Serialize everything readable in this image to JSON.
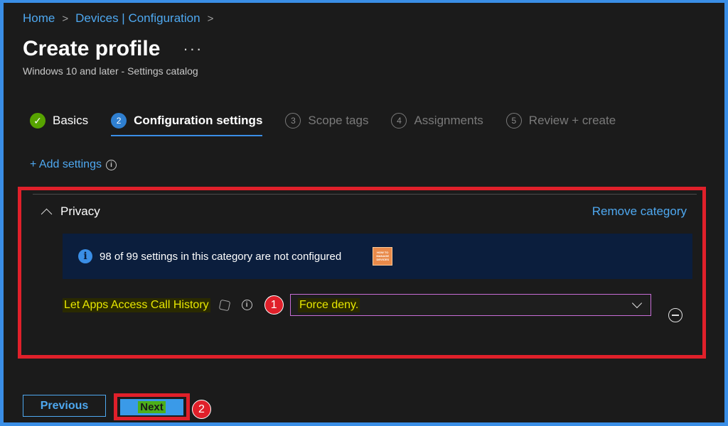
{
  "breadcrumb": {
    "items": [
      "Home",
      "Devices | Configuration"
    ]
  },
  "header": {
    "title": "Create profile",
    "more": "···",
    "subtitle": "Windows 10 and later - Settings catalog"
  },
  "steps": [
    {
      "num": "✓",
      "label": "Basics",
      "state": "done"
    },
    {
      "num": "2",
      "label": "Configuration settings",
      "state": "active"
    },
    {
      "num": "3",
      "label": "Scope tags",
      "state": "pending"
    },
    {
      "num": "4",
      "label": "Assignments",
      "state": "pending"
    },
    {
      "num": "5",
      "label": "Review + create",
      "state": "pending"
    }
  ],
  "add_settings": {
    "label": "+ Add settings",
    "info": "i"
  },
  "category": {
    "name": "Privacy",
    "remove_label": "Remove category",
    "info_text": "98 of 99 settings in this category are not configured",
    "info_icon": "i",
    "logo_lines": [
      "HOW TO",
      "MANAGE",
      "DEVICES"
    ]
  },
  "setting": {
    "label": "Let Apps Access Call History",
    "info": "i",
    "value": "Force deny.",
    "annotation": "1"
  },
  "footer": {
    "previous_label": "Previous",
    "next_label": "Next",
    "annotation": "2"
  },
  "colors": {
    "accent": "#3a8ee6",
    "highlight_border": "#e0202a",
    "link": "#4ea8f0",
    "success": "#57a300",
    "info_bg": "#0b1e3d"
  }
}
